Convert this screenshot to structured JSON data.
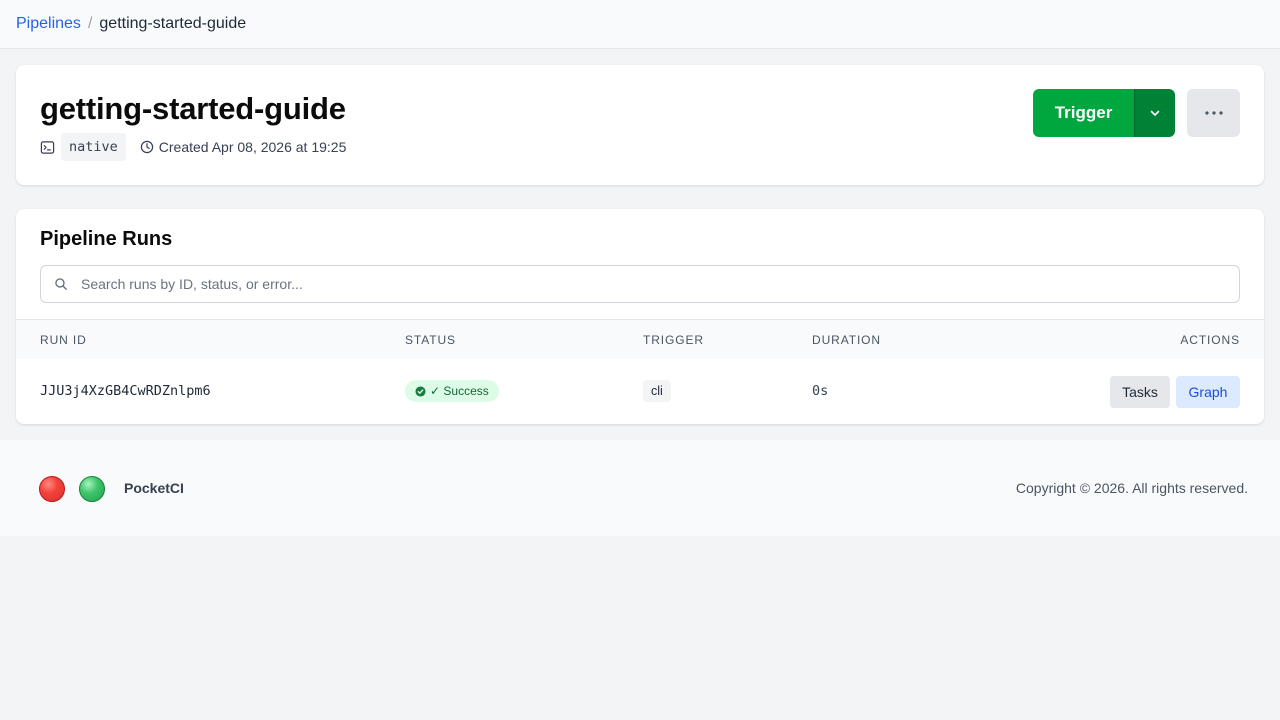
{
  "breadcrumb": {
    "root": "Pipelines",
    "separator": "/",
    "current": "getting-started-guide"
  },
  "pipeline": {
    "name": "getting-started-guide",
    "driver": "native",
    "created": "Created Apr 08, 2026 at 19:25"
  },
  "actions": {
    "trigger_label": "Trigger",
    "more_label": "⋯"
  },
  "runs": {
    "title": "Pipeline Runs",
    "search_placeholder": "Search runs by ID, status, or error...",
    "columns": {
      "run_id": "RUN ID",
      "status": "STATUS",
      "trigger": "TRIGGER",
      "duration": "DURATION",
      "actions": "ACTIONS"
    },
    "rows": [
      {
        "run_id": "JJU3j4XzGB4CwRDZnlpm6",
        "status": "✓ Success",
        "trigger": "cli",
        "duration": "0s",
        "tasks_label": "Tasks",
        "graph_label": "Graph"
      }
    ]
  },
  "footer": {
    "brand": "PocketCI",
    "copyright": "Copyright © 2026. All rights reserved."
  },
  "colors": {
    "accent": "#2563eb",
    "trigger": "#00a63e",
    "trigger_dark": "#008236",
    "success_bg": "#dcfce7",
    "success_text": "#166534",
    "status_red": "#f2433a",
    "status_green": "#3fc56a"
  },
  "icons": {
    "driver": "terminal-icon",
    "created": "clock-icon",
    "caret": "chevron-down-icon",
    "more": "ellipsis-icon",
    "search": "search-icon",
    "status": "check-circle-icon"
  }
}
